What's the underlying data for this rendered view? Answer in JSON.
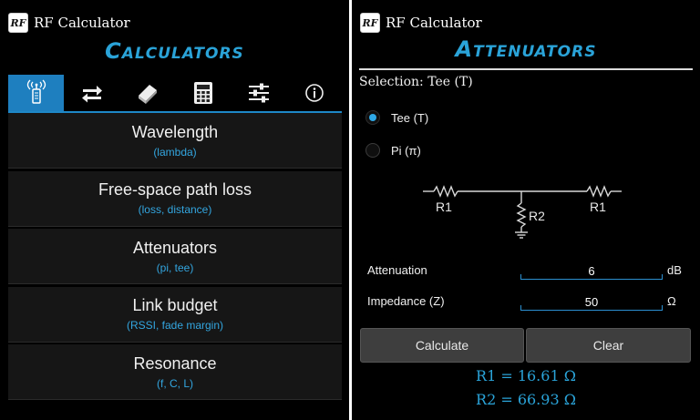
{
  "left": {
    "app_title": "RF Calculator",
    "logo_text": "RF",
    "heading": "Calculators",
    "tabs": [
      {
        "icon": "antenna-phone-icon",
        "active": true
      },
      {
        "icon": "swap-arrows-icon",
        "active": false
      },
      {
        "icon": "book-icon",
        "active": false
      },
      {
        "icon": "calculator-icon",
        "active": false
      },
      {
        "icon": "sliders-icon",
        "active": false
      },
      {
        "icon": "info-icon",
        "active": false
      }
    ],
    "menu": [
      {
        "title": "Wavelength",
        "subtitle": "(lambda)"
      },
      {
        "title": "Free-space path loss",
        "subtitle": "(loss, distance)"
      },
      {
        "title": "Attenuators",
        "subtitle": "(pi, tee)"
      },
      {
        "title": "Link budget",
        "subtitle": "(RSSI, fade margin)"
      },
      {
        "title": "Resonance",
        "subtitle": "(f, C, L)"
      }
    ]
  },
  "right": {
    "app_title": "RF Calculator",
    "logo_text": "RF",
    "heading": "Attenuators",
    "selection": "Selection: Tee (T)",
    "options": [
      {
        "label": "Tee (T)",
        "selected": true
      },
      {
        "label": "Pi (π)",
        "selected": false
      }
    ],
    "schematic": {
      "r1_left": "R1",
      "r2": "R2",
      "r1_right": "R1"
    },
    "attenuation": {
      "label": "Attenuation",
      "value": "6",
      "unit": "dB"
    },
    "impedance": {
      "label": "Impedance (Z)",
      "value": "50",
      "unit": "Ω"
    },
    "calculate_label": "Calculate",
    "clear_label": "Clear",
    "results": [
      "R1 = 16.61 Ω",
      "R2 = 66.93 Ω"
    ]
  },
  "colors": {
    "accent": "#2aa3d8",
    "tab_active": "#1e7fbf",
    "background": "#000000"
  }
}
